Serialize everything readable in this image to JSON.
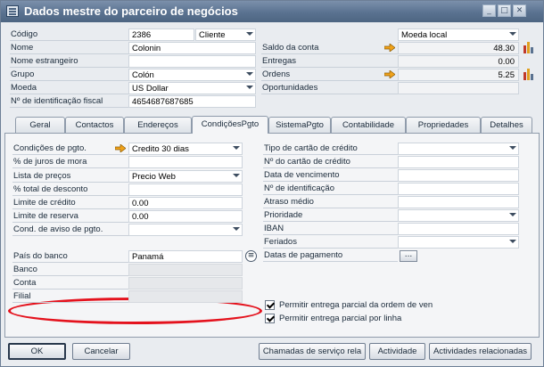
{
  "window": {
    "title": "Dados mestre do parceiro de negócios"
  },
  "header": {
    "codigo_label": "Código",
    "codigo_value": "2386",
    "tipo_value": "Cliente",
    "nome_label": "Nome",
    "nome_value": "Colonin",
    "nome_estrangeiro_label": "Nome estrangeiro",
    "nome_estrangeiro_value": "",
    "grupo_label": "Grupo",
    "grupo_value": "Colón",
    "moeda_label": "Moeda",
    "moeda_value": "US Dollar",
    "id_fiscal_label": "Nº de identificação fiscal",
    "id_fiscal_value": "4654687687685",
    "moeda_local_value": "Moeda local",
    "saldo_label": "Saldo da conta",
    "saldo_value": "48.30",
    "entregas_label": "Entregas",
    "entregas_value": "0.00",
    "ordens_label": "Ordens",
    "ordens_value": "5.25",
    "oportunidades_label": "Oportunidades"
  },
  "tabs": [
    {
      "label": "Geral"
    },
    {
      "label": "Contactos"
    },
    {
      "label": "Endereços"
    },
    {
      "label": "CondiçõesPgto"
    },
    {
      "label": "SistemaPgto"
    },
    {
      "label": "Contabilidade"
    },
    {
      "label": "Propriedades"
    },
    {
      "label": "Detalhes"
    }
  ],
  "active_tab": "CondiçõesPgto",
  "left": {
    "cond_pgto_label": "Condições de pgto.",
    "cond_pgto_value": "Credito 30 dias",
    "juros_mora_label": "% de juros de mora",
    "lista_precos_label": "Lista de preços",
    "lista_precos_value": "Precio Web",
    "total_desconto_label": "% total de desconto",
    "limite_credito_label": "Limite de crédito",
    "limite_credito_value": "0.00",
    "limite_reserva_label": "Limite de reserva",
    "limite_reserva_value": "0.00",
    "cond_aviso_label": "Cond. de aviso de pgto.",
    "pais_banco_label": "País do banco",
    "pais_banco_value": "Panamá",
    "banco_label": "Banco",
    "conta_label": "Conta",
    "filial_label": "Filial"
  },
  "right": {
    "tipo_cartao_label": "Tipo de cartão de crédito",
    "num_cartao_label": "Nº do cartão de crédito",
    "data_venc_label": "Data de vencimento",
    "num_ident_label": "Nº de identificação",
    "atraso_label": "Atraso médio",
    "prioridade_label": "Prioridade",
    "iban_label": "IBAN",
    "feriados_label": "Feriados",
    "datas_pgto_label": "Datas de pagamento",
    "datas_pgto_btn": "...",
    "chk1_label": "Permitir entrega parcial da ordem de ven",
    "chk2_label": "Permitir entrega parcial por linha"
  },
  "footer": {
    "ok": "OK",
    "cancelar": "Cancelar",
    "chamadas": "Chamadas de serviço rela",
    "actividade": "Actividade",
    "actividades_rel": "Actividades relacionadas"
  },
  "colors": {
    "highlight": "#e4121d",
    "arrow": "#f0a21a",
    "title_bar": "#5a7290"
  }
}
